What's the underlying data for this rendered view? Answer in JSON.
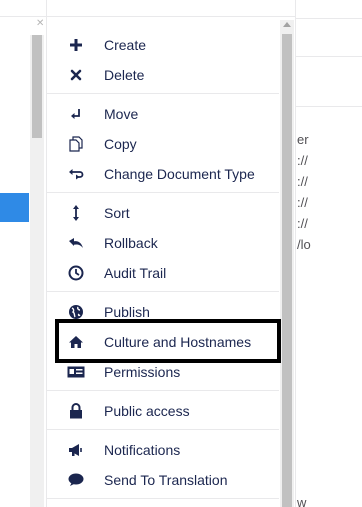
{
  "menu": {
    "groups": [
      [
        {
          "label": "Create",
          "icon": "plus-icon"
        },
        {
          "label": "Delete",
          "icon": "x-icon"
        }
      ],
      [
        {
          "label": "Move",
          "icon": "move-arrow-icon"
        },
        {
          "label": "Copy",
          "icon": "copy-documents-icon"
        },
        {
          "label": "Change Document Type",
          "icon": "swap-arrows-icon"
        }
      ],
      [
        {
          "label": "Sort",
          "icon": "sort-vertical-icon"
        },
        {
          "label": "Rollback",
          "icon": "undo-icon"
        },
        {
          "label": "Audit Trail",
          "icon": "clock-icon"
        }
      ],
      [
        {
          "label": "Publish",
          "icon": "globe-icon"
        },
        {
          "label": "Culture and Hostnames",
          "icon": "home-icon"
        },
        {
          "label": "Permissions",
          "icon": "id-card-icon"
        }
      ],
      [
        {
          "label": "Public access",
          "icon": "lock-icon"
        }
      ],
      [
        {
          "label": "Notifications",
          "icon": "megaphone-icon"
        },
        {
          "label": "Send To Translation",
          "icon": "speech-bubble-icon"
        }
      ]
    ]
  },
  "background_right": {
    "fragments": [
      "er",
      "://",
      "://",
      "://",
      "://",
      "/lo",
      "w"
    ]
  },
  "colors": {
    "menu_text": "#1b264f",
    "selected_node": "#2f8ae6",
    "highlight_border": "#000000"
  }
}
